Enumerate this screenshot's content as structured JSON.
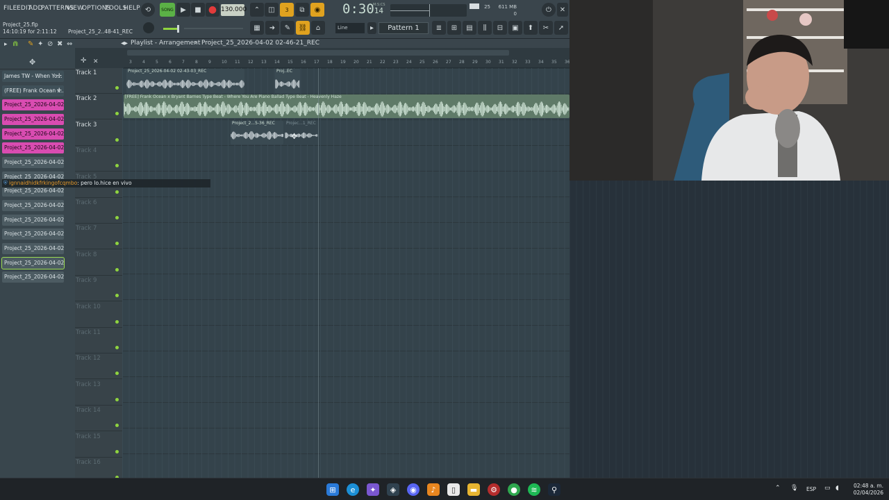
{
  "menu": [
    "FILE",
    "EDIT",
    "ADD",
    "PATTERNS",
    "VIEW",
    "OPTIONS",
    "TOOLS",
    "HELP"
  ],
  "transport": {
    "mode": "SONG",
    "bpm": "130.000",
    "time_main": "0:30",
    "time_sub": "14",
    "time_unit": "M:S:CS",
    "memory": "611 MB",
    "cpu": "25",
    "voices": "0",
    "pattern": "Pattern 1",
    "snap": "Line"
  },
  "hint": {
    "file": "Project_25.flp",
    "clock": "14:10:19 for 2:11:12",
    "recording": "Project_25_2..48-41_REC"
  },
  "playlist": {
    "title": "Playlist - Arrangement",
    "breadcrumb": "Project_25_2026-04-02 02-46-21_REC"
  },
  "ruler": [
    "3",
    "4",
    "5",
    "6",
    "7",
    "8",
    "9",
    "10",
    "11",
    "12",
    "13",
    "14",
    "15",
    "16",
    "17",
    "18",
    "19",
    "20",
    "21",
    "22",
    "23",
    "24",
    "25",
    "26",
    "27",
    "28",
    "29",
    "30",
    "31",
    "32",
    "33",
    "34",
    "35",
    "36"
  ],
  "channels": [
    {
      "label": "James TW - When Yo...",
      "style": "dark",
      "plus": true
    },
    {
      "label": "(FREE) Frank Ocean x...",
      "style": "dark",
      "plus": true
    },
    {
      "label": "Project_25_2026-04-02...",
      "style": "pink"
    },
    {
      "label": "Project_25_2026-04-02...",
      "style": "pink"
    },
    {
      "label": "Project_25_2026-04-02...",
      "style": "pink"
    },
    {
      "label": "Project_25_2026-04-02...",
      "style": "pink"
    },
    {
      "label": "Project_25_2026-04-02...",
      "style": "gray"
    },
    {
      "label": "Project_25_2026-04-02...",
      "style": "gray"
    },
    {
      "label": "Project_25_2026-04-02...",
      "style": "gray"
    },
    {
      "label": "Project_25_2026-04-02...",
      "style": "gray"
    },
    {
      "label": "Project_25_2026-04-02...",
      "style": "gray"
    },
    {
      "label": "Project_25_2026-04-02...",
      "style": "gray"
    },
    {
      "label": "Project_25_2026-04-02...",
      "style": "gray"
    },
    {
      "label": "Project_25_2026-04-02...",
      "style": "gray",
      "selected": true
    },
    {
      "label": "Project_25_2026-04-02...",
      "style": "gray"
    }
  ],
  "tracks": [
    "Track 1",
    "Track 2",
    "Track 3",
    "Track 4",
    "Track 5",
    "Track 6",
    "Track 7",
    "Track 8",
    "Track 9",
    "Track 10",
    "Track 11",
    "Track 12",
    "Track 13",
    "Track 14",
    "Track 15",
    "Track 16"
  ],
  "clips": [
    {
      "title": "Project_25_2026-04-02 02-43-03_REC"
    },
    {
      "title": "Proj..EC"
    },
    {
      "title": "[FREE] Frank Ocean x Bryant Barnes Type Beat - Where You Are  Piano Ballad Type Beat - Heavenly Haze"
    },
    {
      "title": "Project_2...5-36_REC"
    },
    {
      "title": "Projec...1_REC"
    }
  ],
  "chat": {
    "user": "ignnaidhidkfrkingofcqmbo",
    "message": ": pero lo.hice en vivo"
  },
  "taskbar": {
    "lang": "ESP",
    "time": "02:48 a. m.",
    "date": "02/04/2026"
  },
  "colors": {
    "accent_orange": "#e0a21f",
    "clip_green": "#5f7a68",
    "channel_pink": "#d94cb1",
    "led_green": "#8fd43f"
  }
}
